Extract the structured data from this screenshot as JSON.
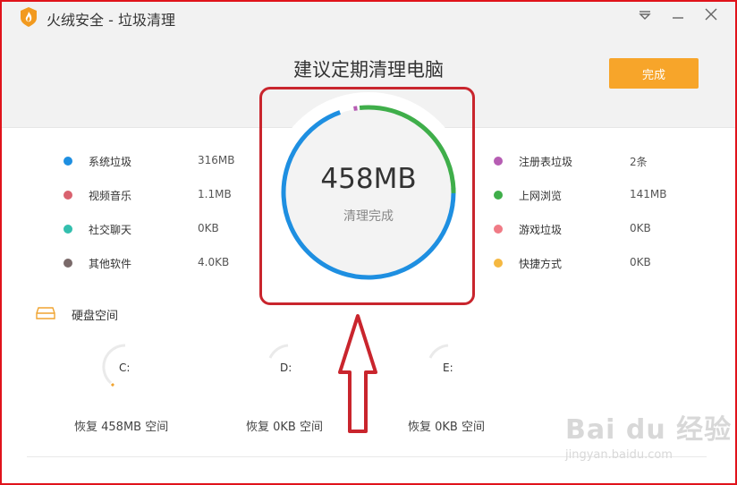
{
  "window": {
    "title": "火绒安全 - 垃圾清理",
    "controls": [
      "menu",
      "minimize",
      "close"
    ]
  },
  "header": {
    "headline": "建议定期清理电脑",
    "done_label": "完成"
  },
  "summary": {
    "total": "458MB",
    "status": "清理完成"
  },
  "left_items": [
    {
      "label": "系统垃圾",
      "value": "316MB",
      "color": "#1e8fe1"
    },
    {
      "label": "视频音乐",
      "value": "1.1MB",
      "color": "#d9626f"
    },
    {
      "label": "社交聊天",
      "value": "0KB",
      "color": "#33bfae"
    },
    {
      "label": "其他软件",
      "value": "4.0KB",
      "color": "#7a6a6a"
    }
  ],
  "right_items": [
    {
      "label": "注册表垃圾",
      "value": "2条",
      "color": "#b65db3"
    },
    {
      "label": "上网浏览",
      "value": "141MB",
      "color": "#3fae4a"
    },
    {
      "label": "游戏垃圾",
      "value": "0KB",
      "color": "#f07b86"
    },
    {
      "label": "快捷方式",
      "value": "0KB",
      "color": "#f5b841"
    }
  ],
  "disk": {
    "section_label": "硬盘空间",
    "drives": [
      {
        "letter": "C:",
        "caption": "恢复 458MB 空间"
      },
      {
        "letter": "D:",
        "caption": "恢复 0KB 空间"
      },
      {
        "letter": "E:",
        "caption": "恢复 0KB 空间"
      }
    ]
  },
  "watermark": {
    "main": "Bai du 经验",
    "sub": "jingyan.baidu.com"
  },
  "colors": {
    "accent": "#f7a52a",
    "ring_blue": "#1e8fe1",
    "ring_green": "#3fae4a",
    "annotation_red": "#c9252d"
  }
}
